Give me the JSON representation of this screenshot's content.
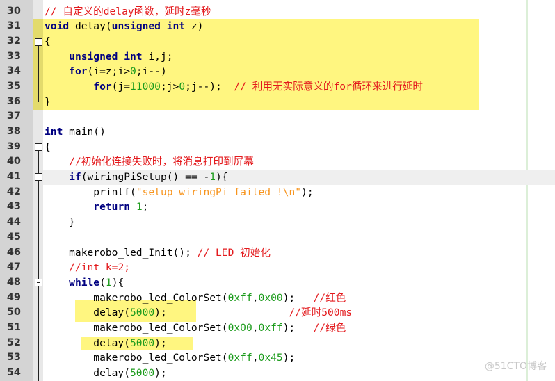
{
  "editor": {
    "highlight_color": "#fff680",
    "colors": {
      "keyword": "#000080",
      "number": "#1c9b1c",
      "string": "#f7941d",
      "comment": "#e3191c"
    },
    "lines": [
      {
        "n": "30",
        "tokens": [
          {
            "t": "cmt",
            "v": "// 自定义的delay函数，延时z毫秒"
          }
        ]
      },
      {
        "n": "31",
        "tokens": [
          {
            "t": "kw",
            "v": "void"
          },
          {
            "t": "",
            "v": " delay("
          },
          {
            "t": "kw",
            "v": "unsigned int"
          },
          {
            "t": "",
            "v": " z)"
          }
        ]
      },
      {
        "n": "32",
        "tokens": [
          {
            "t": "",
            "v": "{"
          }
        ]
      },
      {
        "n": "33",
        "tokens": [
          {
            "t": "",
            "v": "    "
          },
          {
            "t": "kw",
            "v": "unsigned int"
          },
          {
            "t": "",
            "v": " i,j;"
          }
        ]
      },
      {
        "n": "34",
        "tokens": [
          {
            "t": "",
            "v": "    "
          },
          {
            "t": "kw",
            "v": "for"
          },
          {
            "t": "",
            "v": "(i=z;i>"
          },
          {
            "t": "num",
            "v": "0"
          },
          {
            "t": "",
            "v": ";i--)"
          }
        ]
      },
      {
        "n": "35",
        "tokens": [
          {
            "t": "",
            "v": "        "
          },
          {
            "t": "kw",
            "v": "for"
          },
          {
            "t": "",
            "v": "(j="
          },
          {
            "t": "num",
            "v": "11000"
          },
          {
            "t": "",
            "v": ";j>"
          },
          {
            "t": "num",
            "v": "0"
          },
          {
            "t": "",
            "v": ";j--);  "
          },
          {
            "t": "cmt",
            "v": "// 利用无实际意义的for循环来进行延时"
          }
        ]
      },
      {
        "n": "36",
        "tokens": [
          {
            "t": "",
            "v": "}"
          }
        ]
      },
      {
        "n": "37",
        "tokens": []
      },
      {
        "n": "38",
        "tokens": [
          {
            "t": "kw",
            "v": "int"
          },
          {
            "t": "",
            "v": " main()"
          }
        ]
      },
      {
        "n": "39",
        "tokens": [
          {
            "t": "",
            "v": "{"
          }
        ]
      },
      {
        "n": "40",
        "tokens": [
          {
            "t": "",
            "v": "    "
          },
          {
            "t": "cmt",
            "v": "//初始化连接失败时，将消息打印到屏幕"
          }
        ]
      },
      {
        "n": "41",
        "tokens": [
          {
            "t": "",
            "v": "    "
          },
          {
            "t": "kw",
            "v": "if"
          },
          {
            "t": "",
            "v": "(wiringPiSetup() == -"
          },
          {
            "t": "num",
            "v": "1"
          },
          {
            "t": "",
            "v": "){"
          }
        ],
        "caret_line": true
      },
      {
        "n": "42",
        "tokens": [
          {
            "t": "",
            "v": "        printf("
          },
          {
            "t": "str",
            "v": "\"setup wiringPi failed !\\n\""
          },
          {
            "t": "",
            "v": ");"
          }
        ]
      },
      {
        "n": "43",
        "tokens": [
          {
            "t": "",
            "v": "        "
          },
          {
            "t": "kw",
            "v": "return"
          },
          {
            "t": "",
            "v": " "
          },
          {
            "t": "num",
            "v": "1"
          },
          {
            "t": "",
            "v": ";"
          }
        ]
      },
      {
        "n": "44",
        "tokens": [
          {
            "t": "",
            "v": "    }"
          }
        ]
      },
      {
        "n": "45",
        "tokens": []
      },
      {
        "n": "46",
        "tokens": [
          {
            "t": "",
            "v": "    makerobo_led_Init(); "
          },
          {
            "t": "cmt",
            "v": "// LED 初始化"
          }
        ]
      },
      {
        "n": "47",
        "tokens": [
          {
            "t": "",
            "v": "    "
          },
          {
            "t": "cmt",
            "v": "//int k=2;"
          }
        ]
      },
      {
        "n": "48",
        "tokens": [
          {
            "t": "",
            "v": "    "
          },
          {
            "t": "kw",
            "v": "while"
          },
          {
            "t": "",
            "v": "("
          },
          {
            "t": "num",
            "v": "1"
          },
          {
            "t": "",
            "v": "){"
          }
        ]
      },
      {
        "n": "49",
        "tokens": [
          {
            "t": "",
            "v": "        makerobo_led_ColorSet("
          },
          {
            "t": "num",
            "v": "0xff"
          },
          {
            "t": "",
            "v": ","
          },
          {
            "t": "num",
            "v": "0x00"
          },
          {
            "t": "",
            "v": ");   "
          },
          {
            "t": "cmt",
            "v": "//红色"
          }
        ]
      },
      {
        "n": "50",
        "tokens": [
          {
            "t": "",
            "v": "        delay("
          },
          {
            "t": "num",
            "v": "5000"
          },
          {
            "t": "",
            "v": ");                    "
          },
          {
            "t": "cmt",
            "v": "//延时500ms"
          }
        ]
      },
      {
        "n": "51",
        "tokens": [
          {
            "t": "",
            "v": "        makerobo_led_ColorSet("
          },
          {
            "t": "num",
            "v": "0x00"
          },
          {
            "t": "",
            "v": ","
          },
          {
            "t": "num",
            "v": "0xff"
          },
          {
            "t": "",
            "v": ");   "
          },
          {
            "t": "cmt",
            "v": "//绿色"
          }
        ]
      },
      {
        "n": "52",
        "tokens": [
          {
            "t": "",
            "v": "        delay("
          },
          {
            "t": "num",
            "v": "5000"
          },
          {
            "t": "",
            "v": ");"
          }
        ]
      },
      {
        "n": "53",
        "tokens": [
          {
            "t": "",
            "v": "        makerobo_led_ColorSet("
          },
          {
            "t": "num",
            "v": "0xff"
          },
          {
            "t": "",
            "v": ","
          },
          {
            "t": "num",
            "v": "0x45"
          },
          {
            "t": "",
            "v": ");"
          }
        ]
      },
      {
        "n": "54",
        "tokens": [
          {
            "t": "",
            "v": "        delay("
          },
          {
            "t": "num",
            "v": "5000"
          },
          {
            "t": "",
            "v": ");"
          }
        ]
      }
    ]
  },
  "watermark": "@51CTO博客"
}
